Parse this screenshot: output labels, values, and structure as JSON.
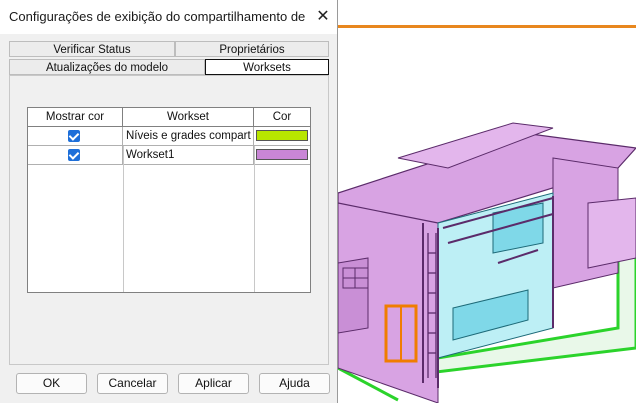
{
  "dialog": {
    "title": "Configurações de exibição do compartilhamento de tr...",
    "tabs": {
      "verificar": "Verificar Status",
      "proprietarios": "Proprietários",
      "atualizacoes": "Atualizações do modelo",
      "worksets": "Worksets"
    },
    "active_tab": "Worksets",
    "table": {
      "headers": [
        "Mostrar cor",
        "Workset",
        "Cor"
      ],
      "rows": [
        {
          "show": true,
          "name": "Níveis e grades compart",
          "color": "#b8e600"
        },
        {
          "show": true,
          "name": "Workset1",
          "color": "#c986d6"
        }
      ]
    },
    "buttons": {
      "ok": "OK",
      "cancel": "Cancelar",
      "apply": "Aplicar",
      "help": "Ajuda"
    }
  },
  "colors": {
    "accent_line": "#e8871e",
    "workset_level_color": "#b8e600",
    "workset1_color": "#c986d6",
    "checkbox": "#1e6fd9"
  }
}
